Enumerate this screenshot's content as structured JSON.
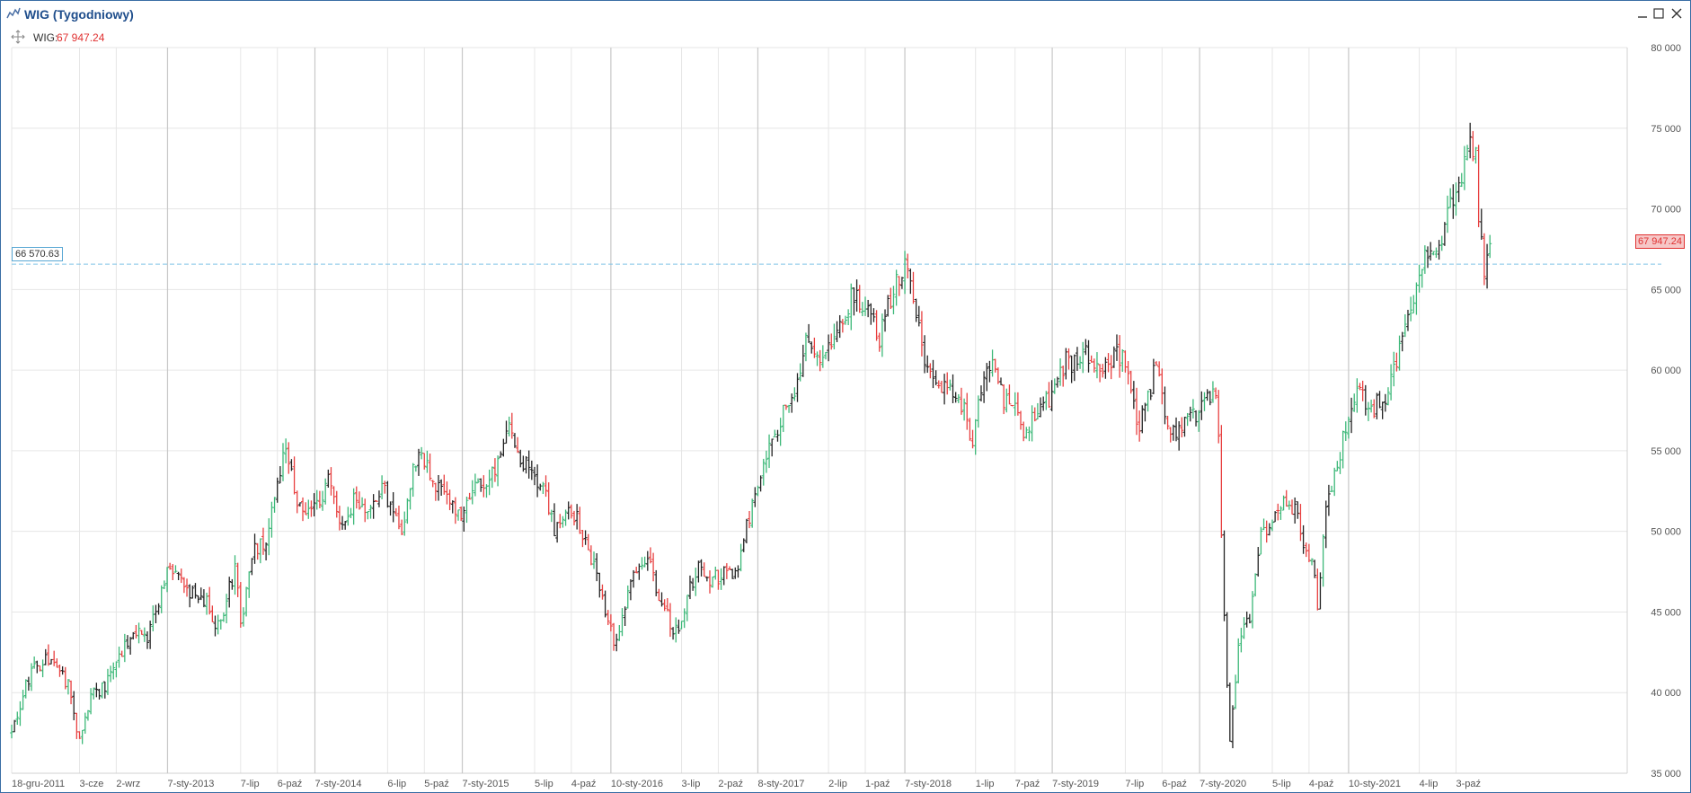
{
  "window": {
    "title": "WIG (Tygodniowy)",
    "legend_label": "WIG:",
    "legend_value": "67 947.24"
  },
  "colors": {
    "up": "#3cb878",
    "down": "#e84040",
    "neutral": "#222222",
    "grid": "#e6e6e6",
    "year_line": "#c8c8c8",
    "ref_line": "#7fc3e6",
    "last_price": "#e03030"
  },
  "chart_data": {
    "type": "ohlc",
    "interval": "weekly",
    "series_name": "WIG",
    "ylim": [
      35000,
      80000
    ],
    "yticks": [
      35000,
      40000,
      45000,
      50000,
      55000,
      60000,
      65000,
      70000,
      75000,
      80000
    ],
    "ytick_labels": [
      "35 000",
      "40 000",
      "45 000",
      "50 000",
      "55 000",
      "60 000",
      "65 000",
      "70 000",
      "75 000",
      "80 000"
    ],
    "x_start": "2011-12-18",
    "x_end": "2022-12-01",
    "xticks": [
      {
        "date": "2011-12-18",
        "label": "18-gru-2011"
      },
      {
        "date": "2012-06-03",
        "label": "3-cze"
      },
      {
        "date": "2012-09-02",
        "label": "2-wrz"
      },
      {
        "date": "2013-01-07",
        "label": "7-sty-2013"
      },
      {
        "date": "2013-07-07",
        "label": "7-lip"
      },
      {
        "date": "2013-10-06",
        "label": "6-paź"
      },
      {
        "date": "2014-01-07",
        "label": "7-sty-2014"
      },
      {
        "date": "2014-07-06",
        "label": "6-lip"
      },
      {
        "date": "2014-10-05",
        "label": "5-paź"
      },
      {
        "date": "2015-01-07",
        "label": "7-sty-2015"
      },
      {
        "date": "2015-07-05",
        "label": "5-lip"
      },
      {
        "date": "2015-10-04",
        "label": "4-paź"
      },
      {
        "date": "2016-01-10",
        "label": "10-sty-2016"
      },
      {
        "date": "2016-07-03",
        "label": "3-lip"
      },
      {
        "date": "2016-10-02",
        "label": "2-paź"
      },
      {
        "date": "2017-01-08",
        "label": "8-sty-2017"
      },
      {
        "date": "2017-07-02",
        "label": "2-lip"
      },
      {
        "date": "2017-10-01",
        "label": "1-paź"
      },
      {
        "date": "2018-01-07",
        "label": "7-sty-2018"
      },
      {
        "date": "2018-07-01",
        "label": "1-lip"
      },
      {
        "date": "2018-10-07",
        "label": "7-paź"
      },
      {
        "date": "2019-01-07",
        "label": "7-sty-2019"
      },
      {
        "date": "2019-07-07",
        "label": "7-lip"
      },
      {
        "date": "2019-10-06",
        "label": "6-paź"
      },
      {
        "date": "2020-01-07",
        "label": "7-sty-2020"
      },
      {
        "date": "2020-07-05",
        "label": "5-lip"
      },
      {
        "date": "2020-10-04",
        "label": "4-paź"
      },
      {
        "date": "2021-01-10",
        "label": "10-sty-2021"
      },
      {
        "date": "2021-07-04",
        "label": "4-lip"
      },
      {
        "date": "2021-10-03",
        "label": "3-paź"
      }
    ],
    "year_lines": [
      "2013-01-07",
      "2014-01-07",
      "2015-01-07",
      "2016-01-10",
      "2017-01-08",
      "2018-01-07",
      "2019-01-07",
      "2020-01-07",
      "2021-01-10"
    ],
    "reference_line": {
      "value": 66570.63,
      "label": "66 570.63"
    },
    "last_price": {
      "value": 67947.24,
      "label": "67 947.24"
    },
    "close_anchors": [
      [
        "2011-12-18",
        37500
      ],
      [
        "2012-02-05",
        41500
      ],
      [
        "2012-03-25",
        42300
      ],
      [
        "2012-05-06",
        40500
      ],
      [
        "2012-06-03",
        37000
      ],
      [
        "2012-07-01",
        39800
      ],
      [
        "2012-08-05",
        40500
      ],
      [
        "2012-09-02",
        42000
      ],
      [
        "2012-10-14",
        44000
      ],
      [
        "2012-11-18",
        43500
      ],
      [
        "2013-01-07",
        47600
      ],
      [
        "2013-02-17",
        46500
      ],
      [
        "2013-04-14",
        45500
      ],
      [
        "2013-05-12",
        44000
      ],
      [
        "2013-06-23",
        47700
      ],
      [
        "2013-07-07",
        44500
      ],
      [
        "2013-08-11",
        48800
      ],
      [
        "2013-09-08",
        49200
      ],
      [
        "2013-10-06",
        53500
      ],
      [
        "2013-10-27",
        54800
      ],
      [
        "2013-12-08",
        50800
      ],
      [
        "2014-01-07",
        51500
      ],
      [
        "2014-02-09",
        53200
      ],
      [
        "2014-03-09",
        50200
      ],
      [
        "2014-04-13",
        52000
      ],
      [
        "2014-05-18",
        51500
      ],
      [
        "2014-06-22",
        53000
      ],
      [
        "2014-07-06",
        52000
      ],
      [
        "2014-08-10",
        49900
      ],
      [
        "2014-09-07",
        54000
      ],
      [
        "2014-09-28",
        55200
      ],
      [
        "2014-10-19",
        53500
      ],
      [
        "2014-12-14",
        51500
      ],
      [
        "2015-01-07",
        51200
      ],
      [
        "2015-02-08",
        52500
      ],
      [
        "2015-03-15",
        52800
      ],
      [
        "2015-04-19",
        55800
      ],
      [
        "2015-05-03",
        57200
      ],
      [
        "2015-05-24",
        55000
      ],
      [
        "2015-06-28",
        53500
      ],
      [
        "2015-07-19",
        53200
      ],
      [
        "2015-08-23",
        50200
      ],
      [
        "2015-09-13",
        51000
      ],
      [
        "2015-10-04",
        51500
      ],
      [
        "2015-11-08",
        49500
      ],
      [
        "2015-12-13",
        46500
      ],
      [
        "2016-01-17",
        43200
      ],
      [
        "2016-02-07",
        44500
      ],
      [
        "2016-03-06",
        47500
      ],
      [
        "2016-04-10",
        48500
      ],
      [
        "2016-05-01",
        46500
      ],
      [
        "2016-06-12",
        44000
      ],
      [
        "2016-06-26",
        43500
      ],
      [
        "2016-07-24",
        46500
      ],
      [
        "2016-08-14",
        47800
      ],
      [
        "2016-09-18",
        47000
      ],
      [
        "2016-10-16",
        47500
      ],
      [
        "2016-11-13",
        47200
      ],
      [
        "2016-12-11",
        50500
      ],
      [
        "2017-01-08",
        52500
      ],
      [
        "2017-02-05",
        55000
      ],
      [
        "2017-03-12",
        57500
      ],
      [
        "2017-04-09",
        58500
      ],
      [
        "2017-05-07",
        61500
      ],
      [
        "2017-06-04",
        60500
      ],
      [
        "2017-07-02",
        61200
      ],
      [
        "2017-08-06",
        63000
      ],
      [
        "2017-09-03",
        64800
      ],
      [
        "2017-10-01",
        64000
      ],
      [
        "2017-11-05",
        62000
      ],
      [
        "2017-12-03",
        64500
      ],
      [
        "2018-01-07",
        66800
      ],
      [
        "2018-01-28",
        64500
      ],
      [
        "2018-02-25",
        60500
      ],
      [
        "2018-03-25",
        59500
      ],
      [
        "2018-04-22",
        59000
      ],
      [
        "2018-05-27",
        58000
      ],
      [
        "2018-06-24",
        55500
      ],
      [
        "2018-07-08",
        58500
      ],
      [
        "2018-08-05",
        60500
      ],
      [
        "2018-09-02",
        58500
      ],
      [
        "2018-10-07",
        57500
      ],
      [
        "2018-10-28",
        55500
      ],
      [
        "2018-11-25",
        57500
      ],
      [
        "2018-12-23",
        58000
      ],
      [
        "2019-01-07",
        58500
      ],
      [
        "2019-02-10",
        60500
      ],
      [
        "2019-03-10",
        60500
      ],
      [
        "2019-04-07",
        61000
      ],
      [
        "2019-05-12",
        60000
      ],
      [
        "2019-06-09",
        61000
      ],
      [
        "2019-07-07",
        60500
      ],
      [
        "2019-08-04",
        56500
      ],
      [
        "2019-08-25",
        57500
      ],
      [
        "2019-09-22",
        60500
      ],
      [
        "2019-10-20",
        56500
      ],
      [
        "2019-11-17",
        56000
      ],
      [
        "2019-12-15",
        57000
      ],
      [
        "2020-01-07",
        57500
      ],
      [
        "2020-01-26",
        58200
      ],
      [
        "2020-02-16",
        58500
      ],
      [
        "2020-02-23",
        55500
      ],
      [
        "2020-03-01",
        50000
      ],
      [
        "2020-03-15",
        40500
      ],
      [
        "2020-03-22",
        37200
      ],
      [
        "2020-04-12",
        43000
      ],
      [
        "2020-05-10",
        44500
      ],
      [
        "2020-06-07",
        49500
      ],
      [
        "2020-07-05",
        50500
      ],
      [
        "2020-08-02",
        52000
      ],
      [
        "2020-08-30",
        51500
      ],
      [
        "2020-09-27",
        48500
      ],
      [
        "2020-10-18",
        47500
      ],
      [
        "2020-10-25",
        45000
      ],
      [
        "2020-11-15",
        51500
      ],
      [
        "2020-12-13",
        54000
      ],
      [
        "2021-01-10",
        57500
      ],
      [
        "2021-02-07",
        58500
      ],
      [
        "2021-03-07",
        57500
      ],
      [
        "2021-04-11",
        58500
      ],
      [
        "2021-05-09",
        60500
      ],
      [
        "2021-06-06",
        63500
      ],
      [
        "2021-07-04",
        66000
      ],
      [
        "2021-08-01",
        67500
      ],
      [
        "2021-08-29",
        68500
      ],
      [
        "2021-09-26",
        70500
      ],
      [
        "2021-10-17",
        71500
      ],
      [
        "2021-11-07",
        74500
      ],
      [
        "2021-11-21",
        73500
      ],
      [
        "2021-11-28",
        69000
      ],
      [
        "2021-12-12",
        66500
      ],
      [
        "2021-12-26",
        67947
      ]
    ]
  }
}
